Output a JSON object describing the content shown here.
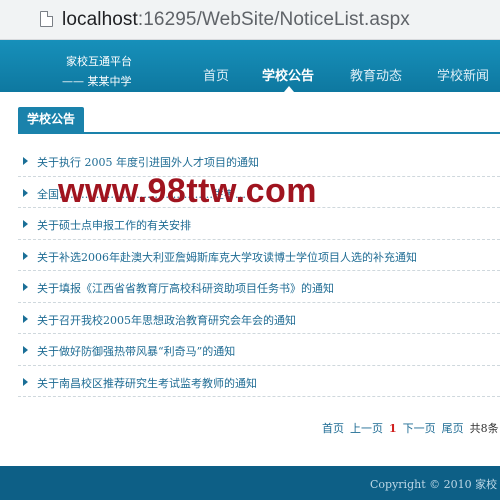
{
  "browser": {
    "url_host": "localhost",
    "url_rest": ":16295/WebSite/NoticeList.aspx",
    "page_icon": "page-icon"
  },
  "header": {
    "brand_line1": "家校互通平台",
    "brand_line2": "—— 某某中学",
    "nav": [
      {
        "label": "首页",
        "active": false
      },
      {
        "label": "学校公告",
        "active": true
      },
      {
        "label": "教育动态",
        "active": false
      },
      {
        "label": "学校新闻",
        "active": false
      }
    ],
    "bg_color": "#1489b3"
  },
  "section": {
    "title": "学校公告"
  },
  "notices": [
    "关于执行 2005 年度引进国外人才项目的通知",
    "全国……………………………………生考…",
    "关于硕士点申报工作的有关安排",
    "关于补选2006年赴澳大利亚詹姆斯库克大学攻读博士学位项目人选的补充通知",
    "关于填报《江西省省教育厅高校科研资助项目任务书》的通知",
    "关于召开我校2005年思想政治教育研究会年会的通知",
    "关于做好防御强热带风暴“利奇马”的通知",
    "关于南昌校区推荐研究生考试监考教师的通知"
  ],
  "watermark": "www.98ttw.com",
  "pager": {
    "first": "首页",
    "prev": "上一页",
    "current": "1",
    "next": "下一页",
    "last": "尾页",
    "total": "共8条"
  },
  "footer": {
    "copyright": "Copyright © 2010 家校"
  }
}
